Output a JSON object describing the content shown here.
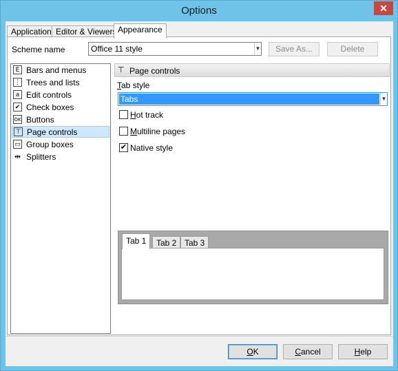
{
  "window": {
    "title": "Options",
    "close_glyph": "✕"
  },
  "tabs": [
    {
      "label": "Application",
      "active": false
    },
    {
      "label": "Editor & Viewers",
      "active": false
    },
    {
      "label": "Appearance",
      "active": true
    }
  ],
  "scheme": {
    "label": "Scheme name",
    "value": "Office 11 style",
    "save_as_label": "Save As...",
    "delete_label": "Delete"
  },
  "categories": [
    {
      "label": "Bars and menus",
      "icon": "bars-menus-icon",
      "glyph": "E"
    },
    {
      "label": "Trees and lists",
      "icon": "tree-icon",
      "glyph": "⋮"
    },
    {
      "label": "Edit controls",
      "icon": "edit-icon",
      "glyph": "a"
    },
    {
      "label": "Check boxes",
      "icon": "checkbox-icon",
      "glyph": "✔"
    },
    {
      "label": "Buttons",
      "icon": "button-icon",
      "glyph": "OK"
    },
    {
      "label": "Page controls",
      "icon": "page-controls-icon",
      "glyph": "⊤",
      "selected": true
    },
    {
      "label": "Group boxes",
      "icon": "group-box-icon",
      "glyph": "▭"
    },
    {
      "label": "Splitters",
      "icon": "splitter-icon",
      "glyph": "⇹"
    }
  ],
  "panel": {
    "header": "Page controls",
    "header_glyph": "⊤",
    "tab_style_label": "Tab style",
    "tab_style_value": "Tabs",
    "options": [
      {
        "label": "Hot track",
        "checked": false
      },
      {
        "label": "Multiline pages",
        "checked": false
      },
      {
        "label": "Native style",
        "checked": true
      }
    ],
    "preview_tabs": [
      "Tab 1",
      "Tab 2",
      "Tab 3"
    ]
  },
  "footer": {
    "ok": "OK",
    "cancel": "Cancel",
    "help": "Help"
  },
  "colors": {
    "titlebar": "#6fc2e8",
    "selection": "#cde8ff",
    "close": "#c7483f",
    "dropdown_highlight": "#3399ff"
  }
}
